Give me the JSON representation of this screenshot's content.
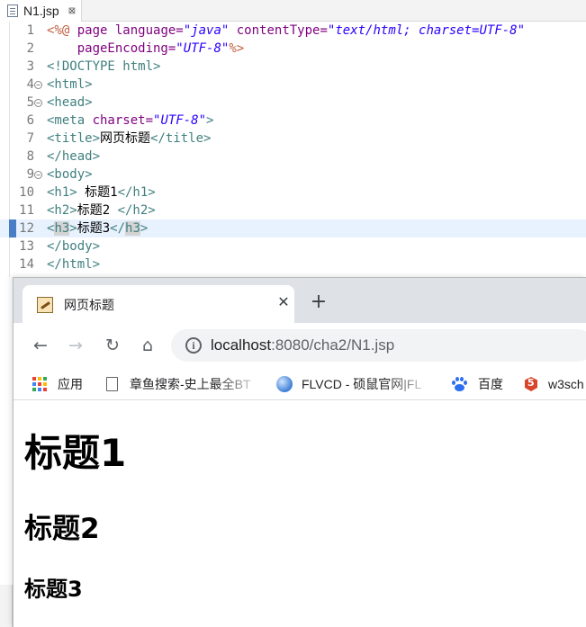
{
  "editor": {
    "tab": {
      "filename": "N1.jsp",
      "close_glyph": "⊠"
    },
    "lines": [
      {
        "num": "1",
        "fold": false,
        "tokens": [
          {
            "t": "<%@ ",
            "c": "jsp"
          },
          {
            "t": "page ",
            "c": "attr"
          },
          {
            "t": "language=",
            "c": "attr"
          },
          {
            "t": "\"java\"",
            "c": "val"
          },
          {
            "t": " contentType=",
            "c": "attr"
          },
          {
            "t": "\"text/html; charset=UTF-8\"",
            "c": "val"
          }
        ]
      },
      {
        "num": "2",
        "fold": false,
        "tokens": [
          {
            "t": "    pageEncoding=",
            "c": "attr"
          },
          {
            "t": "\"UTF-8\"",
            "c": "val"
          },
          {
            "t": "%>",
            "c": "jsp"
          }
        ]
      },
      {
        "num": "3",
        "fold": false,
        "tokens": [
          {
            "t": "<!DOCTYPE html>",
            "c": "tag"
          }
        ]
      },
      {
        "num": "4",
        "fold": true,
        "tokens": [
          {
            "t": "<html>",
            "c": "tag"
          }
        ]
      },
      {
        "num": "5",
        "fold": true,
        "tokens": [
          {
            "t": "<head>",
            "c": "tag"
          }
        ]
      },
      {
        "num": "6",
        "fold": false,
        "tokens": [
          {
            "t": "<meta ",
            "c": "tag"
          },
          {
            "t": "charset=",
            "c": "attr"
          },
          {
            "t": "\"UTF-8\"",
            "c": "val"
          },
          {
            "t": ">",
            "c": "tag"
          }
        ]
      },
      {
        "num": "7",
        "fold": false,
        "tokens": [
          {
            "t": "<title>",
            "c": "tag"
          },
          {
            "t": "网页标题",
            "c": "text"
          },
          {
            "t": "</title>",
            "c": "tag"
          }
        ]
      },
      {
        "num": "8",
        "fold": false,
        "tokens": [
          {
            "t": "</head>",
            "c": "tag"
          }
        ]
      },
      {
        "num": "9",
        "fold": true,
        "tokens": [
          {
            "t": "<body>",
            "c": "tag"
          }
        ]
      },
      {
        "num": "10",
        "fold": false,
        "tokens": [
          {
            "t": "<h1>",
            "c": "tag"
          },
          {
            "t": " 标题1",
            "c": "text"
          },
          {
            "t": "</h1>",
            "c": "tag"
          }
        ]
      },
      {
        "num": "11",
        "fold": false,
        "tokens": [
          {
            "t": "<h2>",
            "c": "tag"
          },
          {
            "t": "标题2 ",
            "c": "text"
          },
          {
            "t": "</h2>",
            "c": "tag"
          }
        ]
      },
      {
        "num": "12",
        "fold": false,
        "current": true,
        "tokens": [
          {
            "t": "<",
            "c": "tag"
          },
          {
            "t": "h3",
            "c": "tag hl"
          },
          {
            "t": ">",
            "c": "tag"
          },
          {
            "t": "标题3",
            "c": "text"
          },
          {
            "t": "</",
            "c": "tag"
          },
          {
            "t": "h3",
            "c": "tag hl"
          },
          {
            "t": ">",
            "c": "tag"
          }
        ]
      },
      {
        "num": "13",
        "fold": false,
        "tokens": [
          {
            "t": "</body>",
            "c": "tag"
          }
        ]
      },
      {
        "num": "14",
        "fold": false,
        "tokens": [
          {
            "t": "</html>",
            "c": "tag"
          }
        ]
      }
    ]
  },
  "browser": {
    "tab_title": "网页标题",
    "tab_close": "✕",
    "new_tab": "+",
    "nav": {
      "back": "←",
      "forward": "→",
      "reload": "↻",
      "home": "⌂"
    },
    "info_glyph": "i",
    "url": {
      "host": "localhost",
      "rest": ":8080/cha2/N1.jsp"
    },
    "bookmarks": {
      "apps": "应用",
      "b1": "章鱼搜索-史上最全BT",
      "b2": "FLVCD - 硕鼠官网|FL",
      "b3": "百度",
      "b4": "w3sch"
    },
    "apps_colors": [
      "#ea4335",
      "#fbbc05",
      "#34a853",
      "#4285f4",
      "#ea4335",
      "#fbbc05",
      "#34a853",
      "#4285f4",
      "#ea4335"
    ],
    "page": {
      "h1": "标题1",
      "h2": "标题2",
      "h3": "标题3"
    }
  }
}
